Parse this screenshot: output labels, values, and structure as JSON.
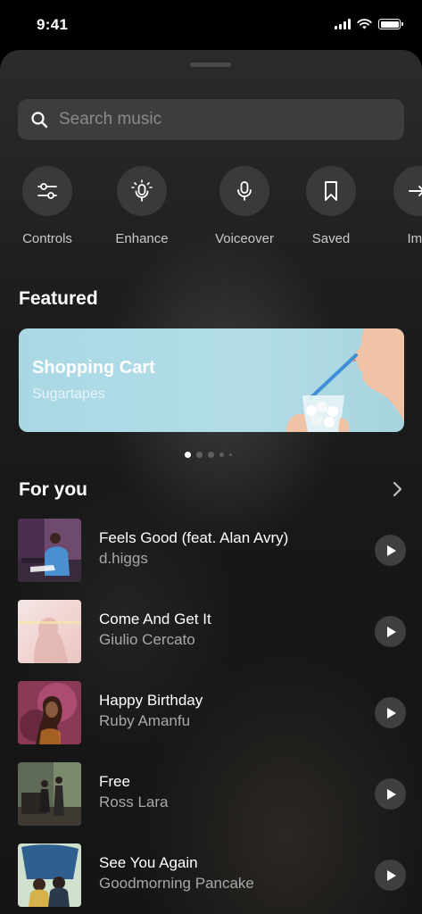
{
  "status_bar": {
    "time": "9:41"
  },
  "search": {
    "placeholder": "Search music",
    "icon": "search-icon"
  },
  "actions": [
    {
      "label": "Controls",
      "icon": "sliders-icon"
    },
    {
      "label": "Enhance",
      "icon": "magic-mic-icon"
    },
    {
      "label": "Voiceover",
      "icon": "microphone-icon"
    },
    {
      "label": "Saved",
      "icon": "bookmark-icon"
    },
    {
      "label": "Imp",
      "icon": "import-icon"
    }
  ],
  "featured": {
    "section_title": "Featured",
    "card": {
      "title": "Shopping Cart",
      "artist": "Sugartapes"
    },
    "pager": {
      "pages": 5,
      "active": 0
    }
  },
  "for_you": {
    "section_title": "For you",
    "tracks": [
      {
        "title": "Feels Good (feat. Alan Avry)",
        "artist": "d.higgs"
      },
      {
        "title": "Come And Get It",
        "artist": "Giulio Cercato"
      },
      {
        "title": "Happy Birthday",
        "artist": "Ruby Amanfu"
      },
      {
        "title": "Free",
        "artist": "Ross Lara"
      },
      {
        "title": "See You Again",
        "artist": "Goodmorning Pancake"
      }
    ]
  },
  "colors": {
    "background": "#000000",
    "sheet": "#1d1d1d",
    "search_field": "#3d3d3d",
    "action_circle": "#3a3a3a",
    "featured_card": "#b2dde8",
    "secondary_text": "#a8a8a8"
  }
}
